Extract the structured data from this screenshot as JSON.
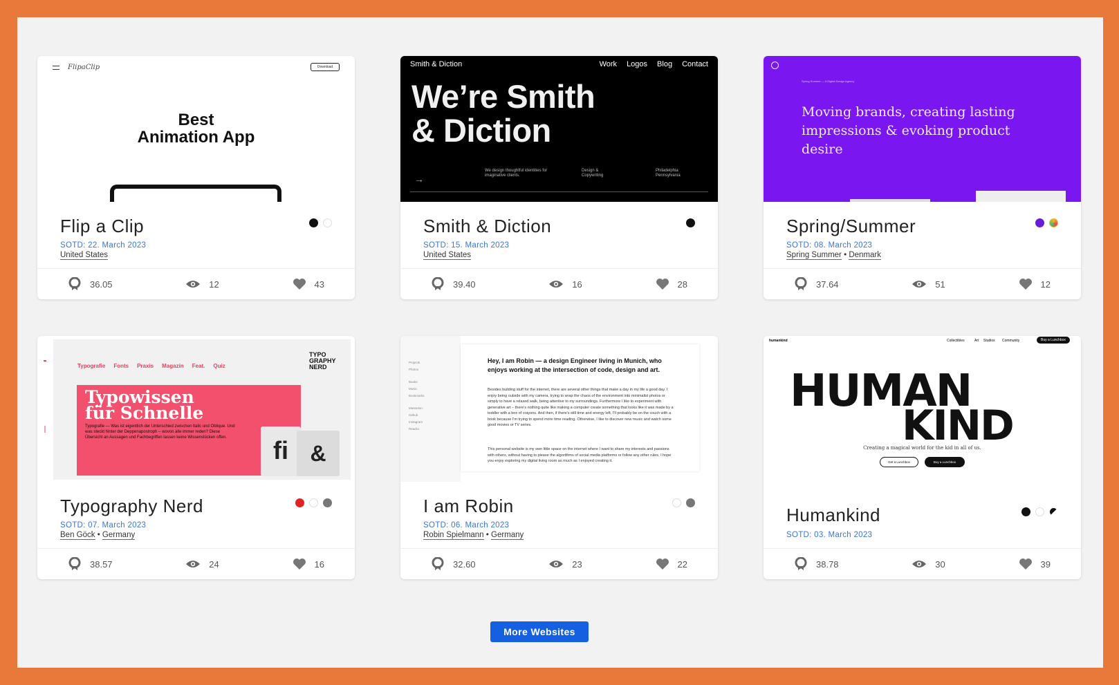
{
  "more_button": "More Websites",
  "cards": [
    {
      "title": "Flip a Clip",
      "sotd": "SOTD: 22. March 2023",
      "meta": [
        "United States"
      ],
      "dots": [
        "#111111",
        "#ffffff"
      ],
      "stats": {
        "score": "36.05",
        "views": "12",
        "likes": "43"
      },
      "thumb": {
        "logo": "FlipaClip",
        "download": "Download",
        "headline_line1": "Best",
        "headline_line2": "Animation App"
      }
    },
    {
      "title": "Smith & Diction",
      "sotd": "SOTD: 15. March 2023",
      "meta": [
        "United States"
      ],
      "dots": [
        "#111111"
      ],
      "stats": {
        "score": "39.40",
        "views": "16",
        "likes": "28"
      },
      "thumb": {
        "brand": "Smith & Diction",
        "nav": [
          "Work",
          "Logos",
          "Blog",
          "Contact"
        ],
        "headline_line1": "We’re Smith",
        "headline_line2": "& Diction",
        "col1": "We design thoughtful identities for imaginative clients.",
        "col2": "Design & Copywriting",
        "col3": "Philadelphia Pennsylvania"
      }
    },
    {
      "title": "Spring/Summer",
      "sotd": "SOTD: 08. March 2023",
      "meta": [
        "Spring Summer",
        "Denmark"
      ],
      "dots": [
        "#6a1bd8",
        "#f0b62a"
      ],
      "stats": {
        "score": "37.64",
        "views": "51",
        "likes": "12"
      },
      "thumb": {
        "tiny": "Spring Summer — A Digital Design Agency",
        "lede": "Moving brands, creating lasting impressions & evoking product desire"
      }
    },
    {
      "title": "Typography Nerd",
      "sotd": "SOTD: 07. March 2023",
      "meta": [
        "Ben Göck",
        "Germany"
      ],
      "dots": [
        "#e02424",
        "#ffffff",
        "#777777"
      ],
      "stats": {
        "score": "38.57",
        "views": "24",
        "likes": "16"
      },
      "thumb": {
        "nav": [
          "Typografie",
          "Fonts",
          "Praxis",
          "Magazin",
          "Feat.",
          "Quiz"
        ],
        "logo": "TYPO GRAPHY NERD",
        "headline_line1": "Typowissen",
        "headline_line2": "für Schnelle",
        "body": "Typografie — Was ist eigentlich der Unterschied zwischen Italic und Oblique. Und was steckt hinter der Deppenapostroph – wovon alle immer reden? Diese Übersicht an Aussagen und Fachbegriffen lassen keine Wissenslücken offen.",
        "glyph1": "fi",
        "glyph2": "&"
      }
    },
    {
      "title": "I am Robin",
      "sotd": "SOTD: 06. March 2023",
      "meta": [
        "Robin Spielmann",
        "Germany"
      ],
      "dots": [
        "#ffffff",
        "#777777"
      ],
      "stats": {
        "score": "32.60",
        "views": "23",
        "likes": "22"
      },
      "thumb": {
        "headline": "Hey, I am Robin — a design Engineer living in Munich, who enjoys working at the intersection of code, design and art.",
        "p1": "Besides building stuff for the internet, there are several other things that make a day in my life a good day. I enjoy being outside with my camera, trying to wrap the chaos of the environment into minimalist photos or simply to have a relaxed walk, being attentive to my surroundings. Furthermore I like to experiment with generative art – there's nothing quite like making a computer create something that looks like it was made by a toddler with a box of crayons. And then, if there's still time and energy left, I'll probably be on the couch with a book because I'm trying to spend more time reading. Otherwise, I like to discover new music and watch some good movies or TV series.",
        "p2": "This personal website is my own little space on the internet where I want to share my interests and passions with others, without having to please the algorithms of social media platforms or follow any other rules. I hope you enjoy exploring my digital living room as much as I enjoyed creating it.",
        "side": [
          "Projects",
          "Photos",
          "Books",
          "Music",
          "Bookmarks",
          "Mastodon",
          "Github",
          "Instagram",
          "Readcv"
        ]
      }
    },
    {
      "title": "Humankind",
      "sotd": "SOTD: 03. March 2023",
      "meta": [],
      "dots": [
        "#111111",
        "#ffffff",
        "#111111"
      ],
      "stats": {
        "score": "38.78",
        "views": "30",
        "likes": "39"
      },
      "thumb": {
        "brand": "humankind",
        "nav": [
          "Collectibles",
          "Art",
          "Studios",
          "Community"
        ],
        "cta": "Buy a Lunchbox",
        "word1": "HUMAN",
        "word2": "KIND",
        "tagline": "Creating a magical world for the kid in all of us.",
        "b1": "Get a Lunchbox",
        "b2": "Buy a Lunchbox"
      }
    }
  ]
}
